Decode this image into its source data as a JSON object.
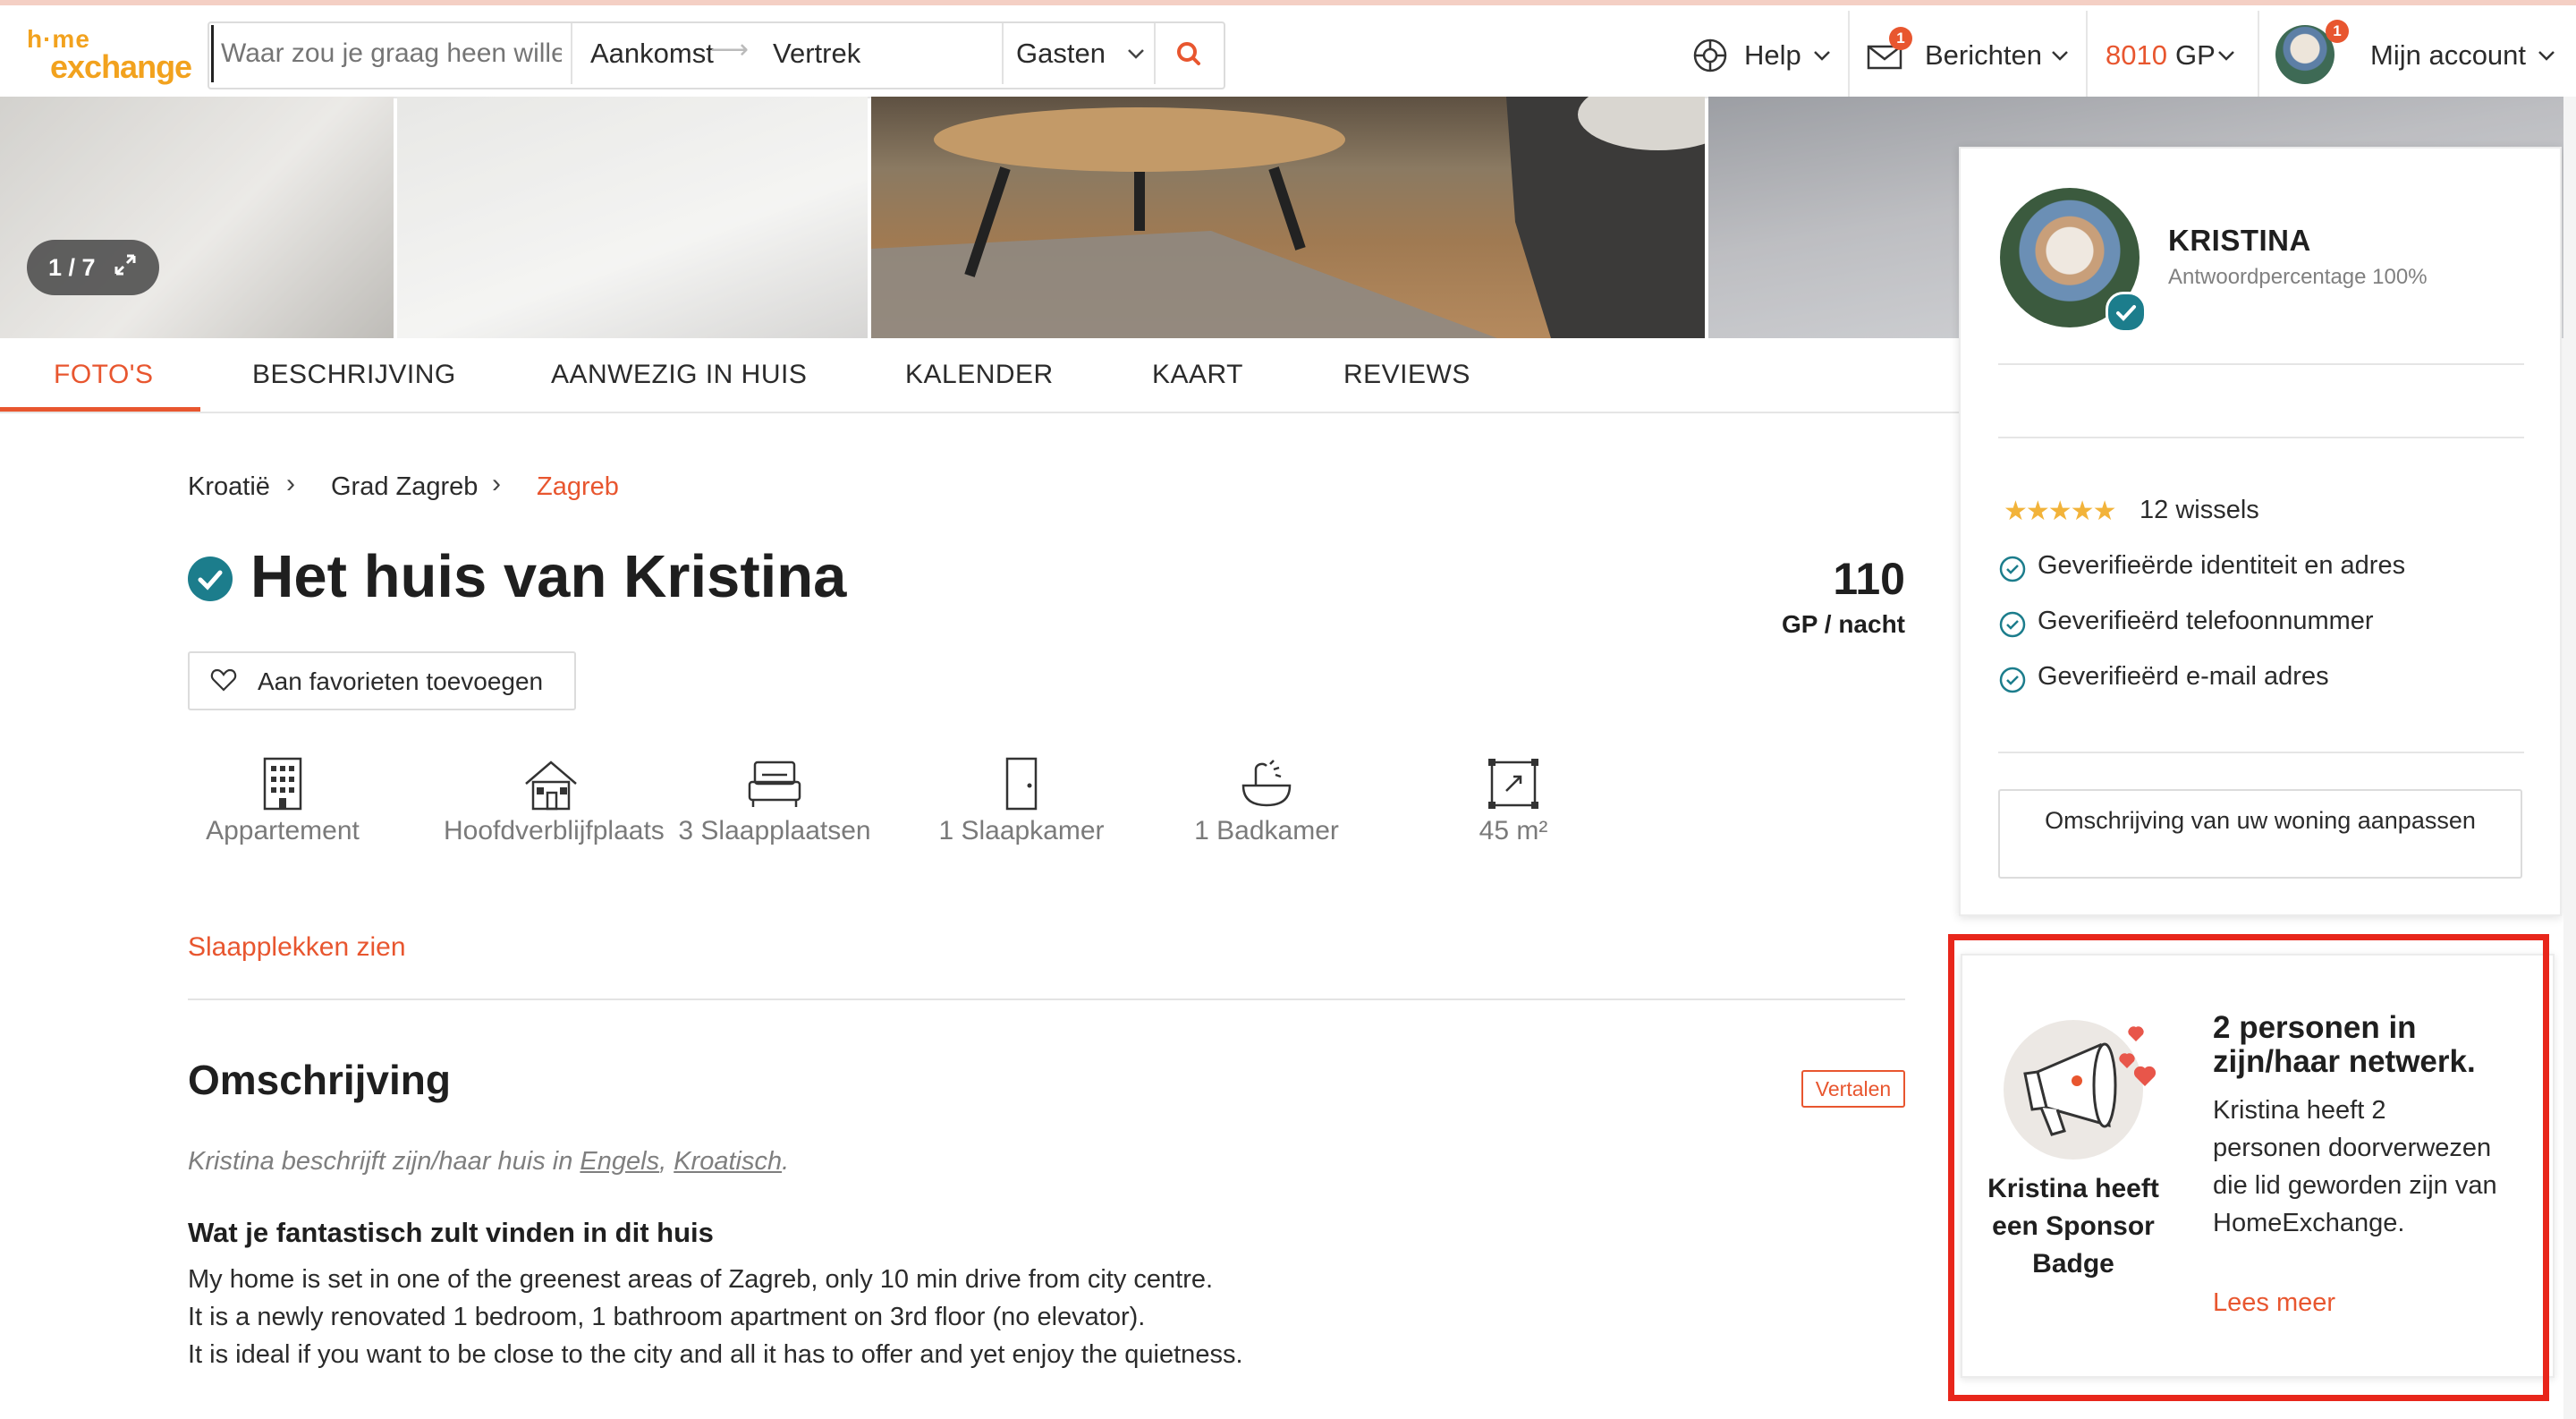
{
  "header": {
    "logo_top": "h·me",
    "logo_bottom": "exchange",
    "search": {
      "where_placeholder": "Waar zou je graag heen willen?",
      "arrival": "Aankomst",
      "departure": "Vertrek",
      "guests": "Gasten"
    },
    "help_label": "Help",
    "messages_label": "Berichten",
    "messages_badge": "1",
    "points_value": "8010",
    "points_unit": "GP",
    "account_label": "Mijn account",
    "account_badge": "1"
  },
  "gallery": {
    "counter": "1 / 7"
  },
  "tabs": [
    {
      "label": "FOTO'S",
      "active": true
    },
    {
      "label": "BESCHRIJVING"
    },
    {
      "label": "AANWEZIG IN HUIS"
    },
    {
      "label": "KALENDER"
    },
    {
      "label": "KAART"
    },
    {
      "label": "REVIEWS"
    }
  ],
  "breadcrumb": [
    "Kroatië",
    "Grad Zagreb",
    "Zagreb"
  ],
  "listing": {
    "title": "Het huis van Kristina",
    "price_value": "110",
    "price_unit": "GP / nacht",
    "favorite_label": "Aan favorieten toevoegen",
    "features": [
      {
        "icon": "apartment-icon",
        "label": "Appartement"
      },
      {
        "icon": "house-icon",
        "label": "Hoofdverblijfplaats"
      },
      {
        "icon": "bed-icon",
        "label": "3 Slaapplaatsen"
      },
      {
        "icon": "door-icon",
        "label": "1 Slaapkamer"
      },
      {
        "icon": "bathtub-icon",
        "label": "1 Badkamer"
      },
      {
        "icon": "area-icon",
        "label": "45 m²"
      }
    ],
    "see_beds_link": "Slaapplekken zien"
  },
  "description": {
    "title": "Omschrijving",
    "translate_label": "Vertalen",
    "note_prefix": "Kristina beschrijft zijn/haar huis in",
    "lang1": "Engels",
    "lang2": "Kroatisch",
    "subtitle": "Wat je fantastisch zult vinden in dit huis",
    "lines": [
      "My home is set in one of the greenest areas of Zagreb, only 10 min drive from city centre.",
      "It is a newly renovated 1 bedroom, 1 bathroom apartment on 3rd floor (no elevator).",
      "It is ideal if you want to be close to the city and all it has to offer and yet enjoy the quietness."
    ]
  },
  "host": {
    "name": "KRISTINA",
    "response_rate": "Antwoordpercentage 100%",
    "rating_stars": 5,
    "stars_glyphs": "★★★★★",
    "swaps": "12 wissels",
    "verifications": [
      "Geverifieërde identiteit en adres",
      "Geverifieërd telefoonnummer",
      "Geverifieërd e-mail adres"
    ],
    "edit_button": "Omschrijving van uw woning aanpassen"
  },
  "sponsor": {
    "badge_text": "Kristina heeft een Sponsor Badge",
    "title": "2 personen in zijn/haar netwerk.",
    "body": "Kristina heeft 2 personen doorverwezen die lid geworden zijn van HomeExchange.",
    "link": "Lees meer"
  },
  "colors": {
    "accent": "#e8562f",
    "logo": "#f2a21e",
    "verified": "#1c7d8c",
    "highlight_box": "#e8261b",
    "star": "#f2b33a"
  }
}
